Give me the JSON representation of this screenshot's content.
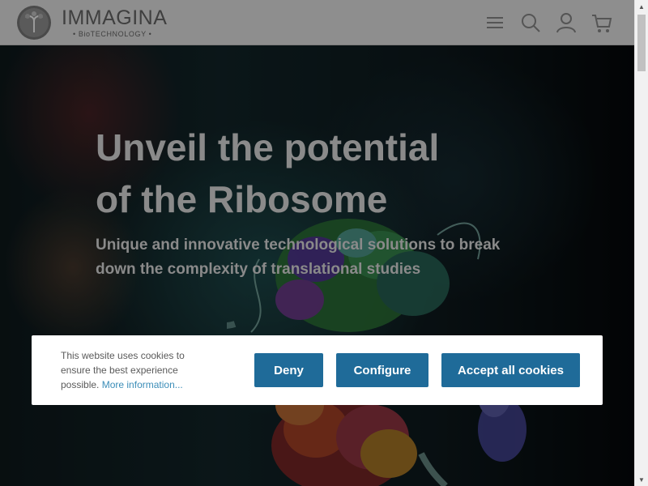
{
  "header": {
    "brand_name": "IMMAGINA",
    "brand_sub": "• BioTECHNOLOGY •",
    "icons": [
      "menu-icon",
      "search-icon",
      "user-icon",
      "cart-icon"
    ]
  },
  "hero": {
    "headline_line1": "Unveil the potential",
    "headline_line2": "of the Ribosome",
    "subheadline": "Unique and innovative technological solutions to break down the complexity of translational studies"
  },
  "cookie_banner": {
    "text": "This website uses cookies to ensure the best experience possible.",
    "link_label": "More information...",
    "deny_label": "Deny",
    "configure_label": "Configure",
    "accept_label": "Accept all cookies"
  },
  "colors": {
    "button_bg": "#1f6b99",
    "link": "#3b8db8",
    "header_bg": "#8e8e8e"
  }
}
